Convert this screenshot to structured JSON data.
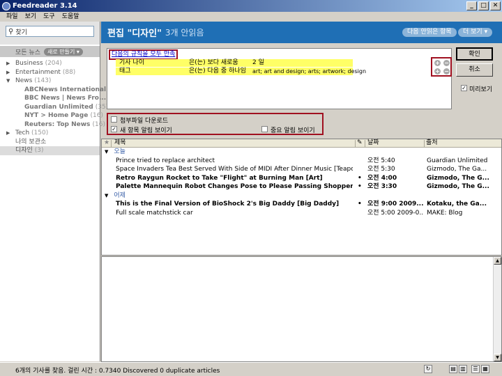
{
  "window": {
    "title": "Feedreader 3.14",
    "min": "_",
    "max": "□",
    "close": "✕"
  },
  "menu": [
    "파일",
    "보기",
    "도구",
    "도움말"
  ],
  "sidebar": {
    "search_placeholder": "찾기",
    "all_news": "모든 뉴스",
    "new_button": "새로 만들기",
    "items": [
      {
        "label": "Business",
        "count": "(204)"
      },
      {
        "label": "Entertainment",
        "count": "(88)"
      },
      {
        "label": "News",
        "count": "(143)"
      },
      {
        "label": "ABCNews International",
        "count": ""
      },
      {
        "label": "BBC News | News Fro...",
        "count": ""
      },
      {
        "label": "Guardian Unlimited",
        "count": "(35)"
      },
      {
        "label": "NYT > Home Page",
        "count": "(16)"
      },
      {
        "label": "Reuters: Top News",
        "count": "(16)"
      },
      {
        "label": "Tech",
        "count": "(150)"
      },
      {
        "label": "나의 보관소",
        "count": ""
      },
      {
        "label": "디자인",
        "count": "(3)"
      }
    ]
  },
  "header": {
    "title": "편집 \"디자인\"",
    "subtitle": "3개 안읽음",
    "unread_btn": "다음 안읽은 항목",
    "more_btn": "더 보기"
  },
  "rules": {
    "match_all": "다음의 규칙을 모두 만족",
    "rows": [
      {
        "field": "기사 나이",
        "op": "은(는) 보다 새로움",
        "value": "2 일"
      },
      {
        "field": "태그",
        "op": "은(는) 다음 중 하나임",
        "value": "art; art and design; arts; artwork; design"
      }
    ],
    "ok": "확인",
    "cancel": "취소",
    "preview": "미리보기",
    "opt_download": "첨부파일 다운로드",
    "opt_notify_new": "새 항목 알림 보이기",
    "opt_notify_important": "중요 알림 보이기"
  },
  "columns": {
    "star": "★",
    "title": "제목",
    "flag": "✎",
    "date": "날짜",
    "source": "출처"
  },
  "groups": {
    "today": "오늘",
    "yesterday": "어제"
  },
  "articles_today": [
    {
      "title": "Prince tried to replace architect",
      "dot": "",
      "date": "오전 5:40",
      "source": "Guardian Unlimited"
    },
    {
      "title": "Space Invaders Tea Best Served With Side of MIDI After Dinner Music [Teapots]",
      "dot": "",
      "date": "오전 5:30",
      "source": "Gizmodo, The Ga..."
    },
    {
      "title": "Retro Raygun Rocket to Take \"Flight\" at Burning Man [Art]",
      "dot": "•",
      "date": "오전 4:00",
      "source": "Gizmodo, The G..."
    },
    {
      "title": "Palette Mannequin Robot Changes Pose to Please Passing Shoppers [Robots]",
      "dot": "•",
      "date": "오전 3:30",
      "source": "Gizmodo, The G..."
    }
  ],
  "articles_yesterday": [
    {
      "title": "This is the Final Version of BioShock 2's Big Daddy [Big Daddy]",
      "dot": "•",
      "date": "오전 9:00 2009...",
      "source": "Kotaku, the Ga..."
    },
    {
      "title": "Full scale matchstick car",
      "dot": "",
      "date": "오전 5:00 2009-0...",
      "source": "MAKE: Blog"
    }
  ],
  "status": {
    "text": "6개의 기사를 찾음. 걸린 시간 : 0.7340 Discovered 0 duplicate articles"
  }
}
